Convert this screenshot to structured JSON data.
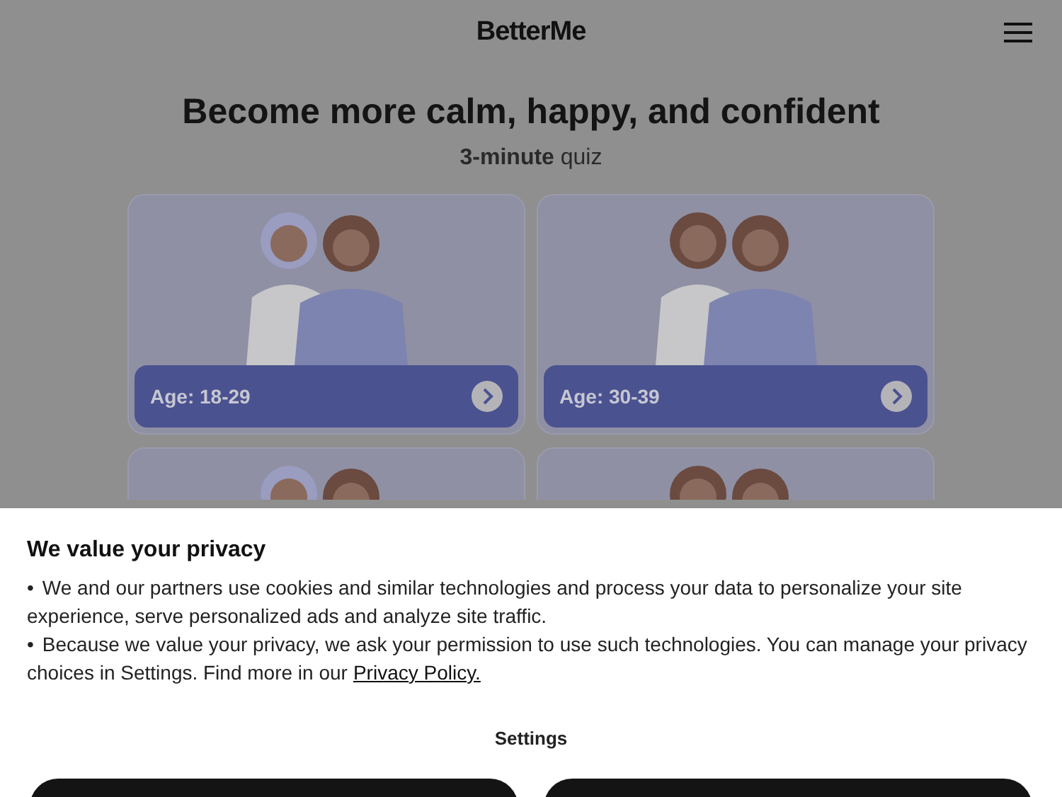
{
  "header": {
    "logo": "BetterMe"
  },
  "hero": {
    "title": "Become more calm, happy, and confident",
    "subtitle_bold": "3-minute",
    "subtitle_rest": "quiz"
  },
  "cards": [
    {
      "kind": "full",
      "label": "Age: 18-29"
    },
    {
      "kind": "full",
      "label": "Age: 30-39"
    },
    {
      "kind": "cut"
    },
    {
      "kind": "cut"
    }
  ],
  "cookie_banner": {
    "title": "We value your privacy",
    "bullets": [
      {
        "marker": "•",
        "text": "We and our partners use cookies and similar technologies and process your data to personalize your site experience, serve personalized ads and analyze site traffic."
      },
      {
        "marker": "•",
        "text": "Because we value your privacy, we ask your permission to use such technologies. You can manage your privacy choices in Settings. Find more in our",
        "link": "Privacy Policy."
      }
    ],
    "settings": "Settings"
  }
}
